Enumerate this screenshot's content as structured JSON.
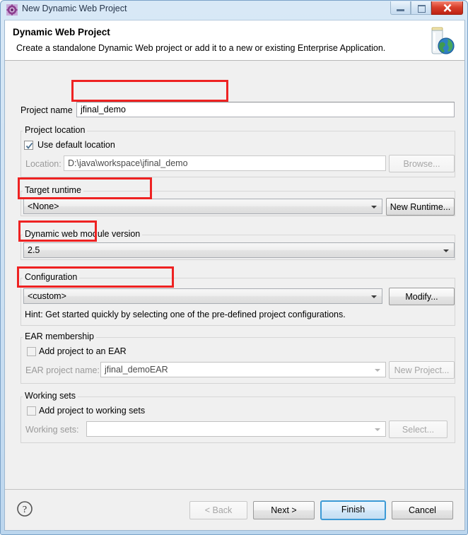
{
  "window": {
    "title": "New Dynamic Web Project",
    "app_icon": "gear-icon",
    "controls": {
      "minimize": "minimize-icon",
      "maximize": "maximize-icon",
      "close": "close-icon"
    },
    "accent_color": "#3c9ad6",
    "annotation_color": "#ee2222"
  },
  "banner": {
    "title": "Dynamic Web Project",
    "description": "Create a standalone Dynamic Web project or add it to a new or existing Enterprise Application.",
    "icon": "web-project-jar-globe-icon"
  },
  "form": {
    "project_name": {
      "label": "Project name:",
      "label_text": "Project name",
      "value": "jfinal_demo",
      "placeholder": ""
    },
    "project_location": {
      "group_label": "Project location",
      "use_default_label": "Use default location",
      "use_default_checked": true,
      "location_label": "Location:",
      "location_value": "D:\\java\\workspace\\jfinal_demo",
      "browse_label": "Browse...",
      "browse_enabled": false
    },
    "target_runtime": {
      "group_label": "Target runtime",
      "value": "<None>",
      "new_runtime_label": "New Runtime...",
      "new_runtime_enabled": true
    },
    "module_version": {
      "group_label": "Dynamic web module version",
      "value": "2.5"
    },
    "configuration": {
      "group_label": "Configuration",
      "value": "<custom>",
      "modify_label": "Modify...",
      "modify_enabled": true,
      "hint": "Hint: Get started quickly by selecting one of the pre-defined project configurations."
    },
    "ear_membership": {
      "group_label": "EAR membership",
      "add_to_ear_label": "Add project to an EAR",
      "add_to_ear_checked": false,
      "ear_project_name_label": "EAR project name:",
      "ear_project_name_value": "jfinal_demoEAR",
      "new_project_label": "New Project...",
      "new_project_enabled": false
    },
    "working_sets": {
      "group_label": "Working sets",
      "add_to_working_sets_label": "Add project to working sets",
      "add_to_working_sets_checked": false,
      "working_sets_label": "Working sets:",
      "working_sets_value": "",
      "select_label": "Select...",
      "select_enabled": false
    }
  },
  "footer": {
    "help_icon": "help-question-icon",
    "back_label": "< Back",
    "back_enabled": false,
    "next_label": "Next >",
    "next_enabled": true,
    "finish_label": "Finish",
    "finish_is_default": true,
    "cancel_label": "Cancel"
  },
  "annotations": [
    {
      "name": "project-name-highlight"
    },
    {
      "name": "target-runtime-highlight"
    },
    {
      "name": "module-version-highlight"
    },
    {
      "name": "configuration-highlight"
    }
  ]
}
